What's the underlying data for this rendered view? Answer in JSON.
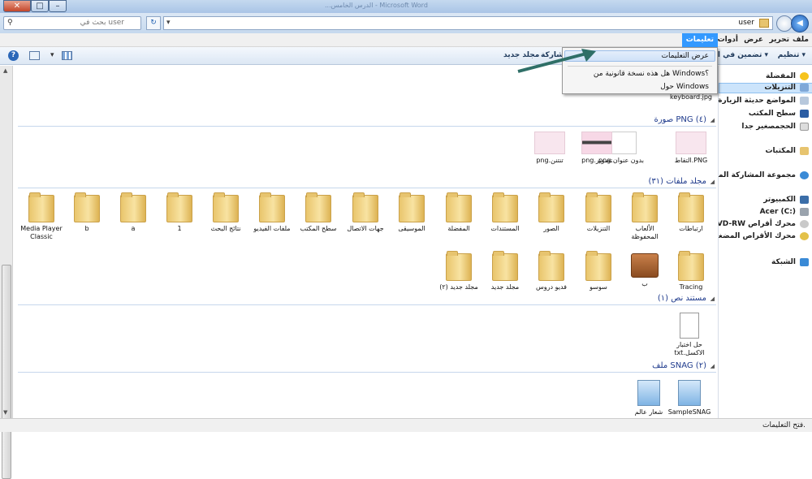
{
  "window": {
    "title": "...الدرس الخامس - Microsoft Word",
    "min": "–",
    "max": "□",
    "close": "✕"
  },
  "address": {
    "path": "user",
    "back": "◀",
    "fwd": "▶",
    "refresh": "↻"
  },
  "search": {
    "placeholder": "بحث في user"
  },
  "menu": {
    "file": "ملف",
    "edit": "تحرير",
    "view": "عرض",
    "tools": "أدوات",
    "help": "تعليمات"
  },
  "toolbar": {
    "organize": "تنظيم ▾",
    "include": "تضمين في المكتبة ▾",
    "share": "مشاركة",
    "new_folder": "مجلد جديد",
    "help_icon": "?"
  },
  "dropdown": {
    "view_help": "عرض التعليمات",
    "genuine": "هل هذه نسخة قانونية من Windows؟",
    "about": "حول Windows"
  },
  "nav": {
    "favorites": "المفضلة",
    "downloads": "التنزيلات",
    "recent": "المواضع حديثة الزيارة",
    "desktop": "سطح المكتب",
    "big": "الحجمصغير جدا",
    "libraries": "المكتبات",
    "homegroup": "مجموعة المشاركة المنزلية",
    "computer": "الكمبيوتر",
    "acer": "Acer (C:)",
    "dvd": "محرك أقراص DVD-RW",
    "cd": "محرك الأقراص المضغوطة",
    "network": "الشبكة"
  },
  "groups": {
    "png": "صورة PNG (٤)",
    "folders": "مجلد ملفات (٣١)",
    "text": "مستند نص (١)",
    "snag": "ملف SNAG (٢)"
  },
  "files": {
    "keyboard": "keyboard.jpg",
    "png_items": [
      "PNG.التقاط",
      "بدون عنوان.png",
      "تصوير.png",
      "تنتنن.png"
    ],
    "row1": [
      "ارتباطات",
      "الألعاب المحفوظة",
      "التنزيلات",
      "الصور",
      "المستندات",
      "المفضلة",
      "الموسيقى",
      "جهات الاتصال",
      "سطح المكتب",
      "ملفات الفيديو",
      "نتائج البحث",
      "1",
      "a",
      "b",
      "Media Player Classic"
    ],
    "row2": [
      "Tracing",
      "ب",
      "سوسو",
      "فديو دروس",
      "مجلد جديد",
      "مجلد جديد (٢)"
    ],
    "txt_item": "حل اختبار الاكسل.txt",
    "snag_items": [
      "SampleSNAG",
      "شعار عالم"
    ]
  },
  "status": {
    "text": "فتح التعليمات."
  }
}
